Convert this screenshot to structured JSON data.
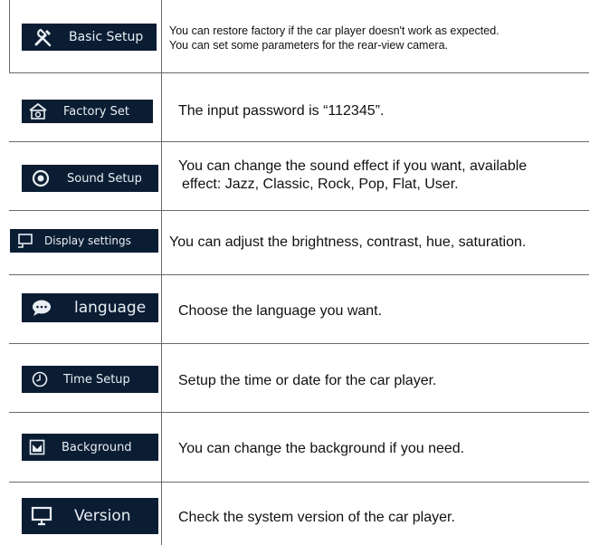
{
  "rows": [
    {
      "button_label": "Basic Setup",
      "icon": "tools-icon",
      "description": [
        "You can restore factory if the car player doesn't work as expected.",
        "You can set some parameters for the rear-view camera."
      ]
    },
    {
      "button_label": "Factory Set",
      "icon": "factory-icon",
      "description": [
        "The input password is “112345”."
      ]
    },
    {
      "button_label": "Sound Setup",
      "icon": "speaker-icon",
      "description": [
        "You can change the sound effect if you want, available",
        "effect: Jazz, Classic, Rock, Pop, Flat, User."
      ]
    },
    {
      "button_label": "Display settings",
      "icon": "monitor-hand-icon",
      "description": [
        "You can adjust the brightness, contrast, hue, saturation."
      ]
    },
    {
      "button_label": "language",
      "icon": "speech-bubble-icon",
      "description": [
        "Choose the language you want."
      ]
    },
    {
      "button_label": "Time Setup",
      "icon": "clock-icon",
      "description": [
        "Setup the time or date for the car player."
      ]
    },
    {
      "button_label": "Background",
      "icon": "background-picture-icon",
      "description": [
        "You can change the background if you need."
      ]
    },
    {
      "button_label": "Version",
      "icon": "monitor-icon",
      "description": [
        "Check the system version of the car player."
      ]
    }
  ],
  "colors": {
    "button_bg": "#0a1d33",
    "button_text": "#e9eef3",
    "grid_line": "#6a6a6a",
    "text": "#111111"
  }
}
